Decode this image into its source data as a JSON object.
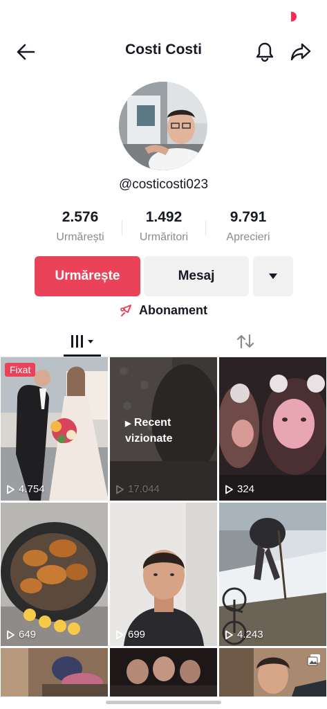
{
  "header": {
    "title": "Costi Costi"
  },
  "profile": {
    "username": "@costicosti023"
  },
  "stats": [
    {
      "value": "2.576",
      "label": "Urmărești"
    },
    {
      "value": "1.492",
      "label": "Urmăritori"
    },
    {
      "value": "9.791",
      "label": "Aprecieri"
    }
  ],
  "actions": {
    "follow": "Urmărește",
    "message": "Mesaj",
    "subscription": "Abonament"
  },
  "grid": {
    "pinned_label": "Fixat",
    "recent_label_line1": "Recent",
    "recent_label_line2": "vizionate",
    "views": [
      "4.754",
      "17.044",
      "324",
      "649",
      "699",
      "4.243"
    ]
  },
  "colors": {
    "accent": "#ea4359",
    "text": "#161823",
    "muted": "#8a8b91"
  },
  "icons": [
    "back-arrow-icon",
    "bell-icon",
    "share-icon",
    "caret-down-icon",
    "subscription-icon",
    "grid-icon",
    "repost-icon",
    "play-icon",
    "multi-photo-icon"
  ]
}
